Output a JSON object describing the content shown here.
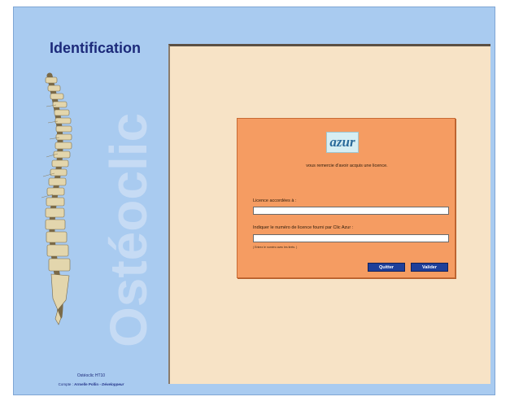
{
  "sidebar": {
    "title": "Identification",
    "watermark": "Ostéoclic",
    "footer": {
      "app_name": "Ostéoclic HT10",
      "credit_prefix": "Compte :",
      "credit_author": "Armelle Pollin",
      "credit_role": "- Développeur"
    }
  },
  "dialog": {
    "logo_text": "azur",
    "thanks_text": "vous remercie d'avoir acquis une licence.",
    "license_label": "Licence accordées à :",
    "license_value": "",
    "number_label": "Indiquer le numéro de licence fourni par Clic Azur :",
    "number_value": "",
    "hint": "( Entrez le numéro avec les tirets. )",
    "quit_label": "Quitter",
    "validate_label": "Valider"
  },
  "colors": {
    "sidebar_bg": "#a9cbf0",
    "panel_bg": "#f7e3c6",
    "dialog_bg": "#f59c62",
    "button_bg": "#1f3f9a",
    "title_color": "#1c2a7a"
  }
}
